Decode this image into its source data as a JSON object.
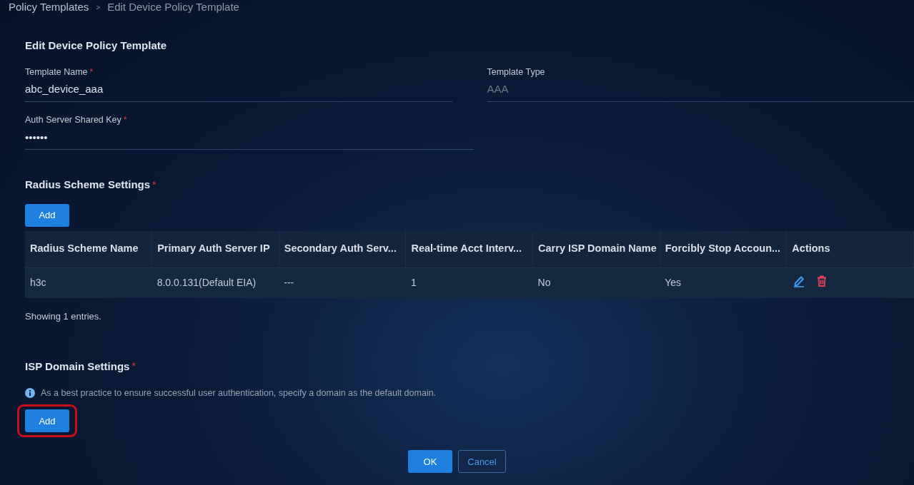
{
  "breadcrumb": [
    {
      "label": "Policy Templates",
      "current": false
    },
    {
      "label": "Edit Device Policy Template",
      "current": true
    }
  ],
  "breadcrumb_separator": ">",
  "form_title": "Edit Device Policy Template",
  "fields": [
    {
      "label": "Template Name",
      "required_mark": "*",
      "value": "abc_device_aaa",
      "disabled": false
    },
    {
      "label": "Template Type",
      "value": "AAA",
      "disabled": true
    },
    {
      "label": "Auth Server Shared Key",
      "required_mark": "*",
      "value": "••••••",
      "disabled": false
    }
  ],
  "radius_section": {
    "title": "Radius Scheme Settings",
    "required_mark": "*",
    "add_button": {
      "label": "Add"
    },
    "table": {
      "columns": [
        "Radius Scheme Name",
        "Primary Auth Server IP",
        "Secondary Auth Serv...",
        "Real-time Acct Interv...",
        "Carry ISP Domain Name",
        "Forcibly Stop Accoun...",
        "Actions"
      ],
      "rows": [
        {
          "cells": [
            "h3c",
            "8.0.0.131(Default EIA)",
            "---",
            "1",
            "No",
            "Yes"
          ]
        }
      ]
    },
    "footer": "Showing 1 entries."
  },
  "isp_section": {
    "title": "ISP Domain Settings",
    "required_mark": "*",
    "info": "As a best practice to ensure successful user authentication, specify a domain as the default domain.",
    "add_button": {
      "label": "Add",
      "highlighted": true
    }
  },
  "buttons": [
    {
      "label": "OK",
      "kind": "primary"
    },
    {
      "label": "Cancel",
      "kind": "secondary"
    }
  ]
}
